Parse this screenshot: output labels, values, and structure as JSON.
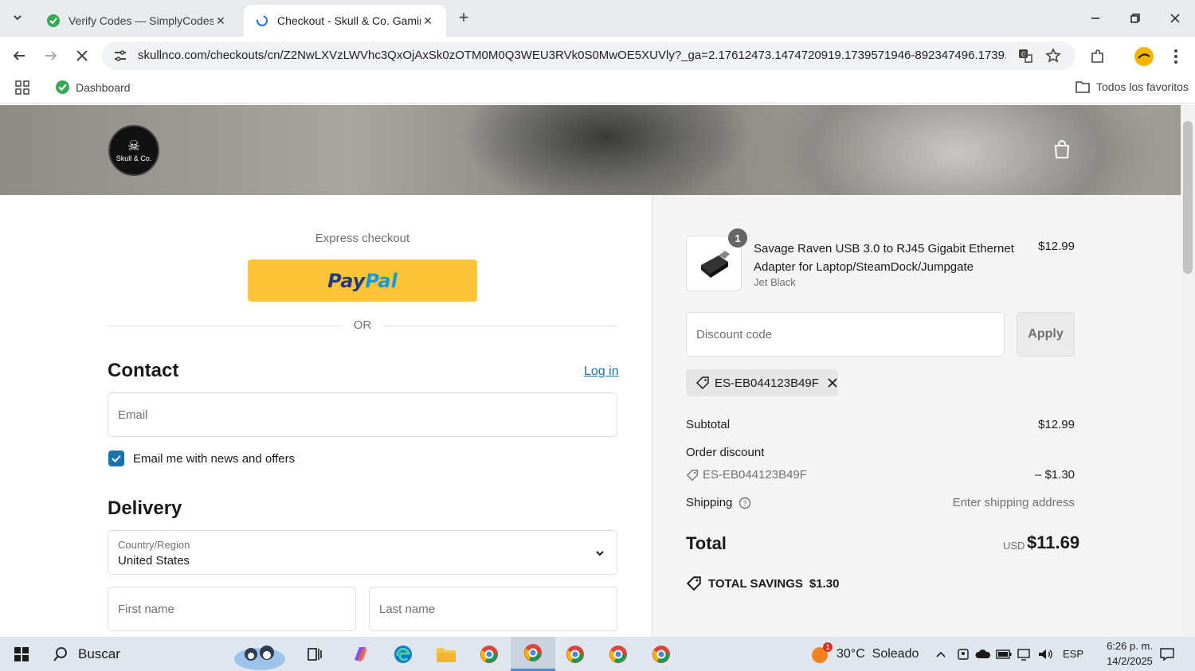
{
  "browser": {
    "tabs": [
      {
        "title": "Verify Codes — SimplyCodes",
        "active": false
      },
      {
        "title": "Checkout - Skull & Co. Gaming",
        "active": true
      }
    ],
    "url": "skullnco.com/checkouts/cn/Z2NwLXVzLWVhc3QxOjAxSk0zOTM0M0Q3WEU3RVk0S0MwOE5XUVly?_ga=2.17612473.1474720919.1739571946-892347496.1739...",
    "bookmarks": {
      "dashboard": "Dashboard",
      "all_favorites": "Todos los favoritos"
    }
  },
  "header": {
    "logo_text": "Skull & Co."
  },
  "checkout": {
    "express_title": "Express checkout",
    "paypal_part1": "Pay",
    "paypal_part2": "Pal",
    "or_text": "OR",
    "contact_title": "Contact",
    "login_link": "Log in",
    "email_placeholder": "Email",
    "newsletter_label": "Email me with news and offers",
    "newsletter_checked": true,
    "delivery_title": "Delivery",
    "country_label": "Country/Region",
    "country_value": "United States",
    "first_name_placeholder": "First name",
    "last_name_placeholder": "Last name"
  },
  "summary": {
    "item": {
      "quantity": "1",
      "name": "Savage Raven USB 3.0 to RJ45 Gigabit Ethernet Adapter for Laptop/SteamDock/Jumpgate",
      "variant": "Jet Black",
      "price": "$12.99"
    },
    "discount_placeholder": "Discount code",
    "apply_label": "Apply",
    "applied_code": "ES-EB044123B49F",
    "subtotal_label": "Subtotal",
    "subtotal_value": "$12.99",
    "order_discount_label": "Order discount",
    "order_discount_code": "ES-EB044123B49F",
    "order_discount_value": "– $1.30",
    "shipping_label": "Shipping",
    "shipping_value": "Enter shipping address",
    "total_label": "Total",
    "total_currency": "USD",
    "total_value": "$11.69",
    "savings_label": "TOTAL SAVINGS",
    "savings_value": "$1.30"
  },
  "taskbar": {
    "search_placeholder": "Buscar",
    "weather": "30°C  Soleado",
    "weather_badge": "1",
    "language": "ESP",
    "time": "6:26 p. m.",
    "date": "14/2/2025"
  },
  "colors": {
    "accent_link": "#1773b0",
    "paypal_yellow": "#ffc439"
  }
}
